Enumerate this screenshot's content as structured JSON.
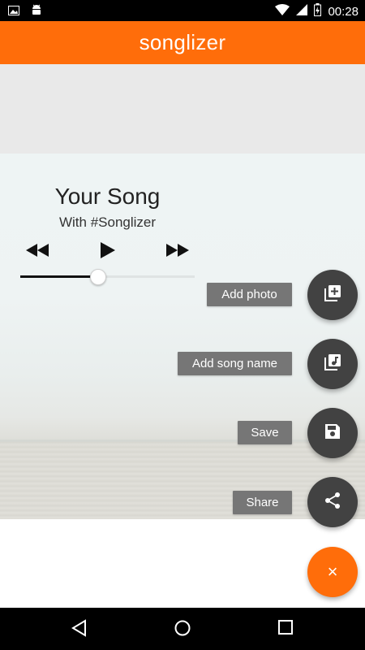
{
  "status_bar": {
    "time": "00:28",
    "icons": [
      "image-notification-icon",
      "android-debug-icon",
      "wifi-icon",
      "signal-icon",
      "battery-charging-icon"
    ]
  },
  "app_bar": {
    "title_bold": "song",
    "title_light": "lizer",
    "color": "#ff6d0a"
  },
  "player": {
    "title": "Your Song",
    "subtitle": "With #Songlizer",
    "progress": 0.44
  },
  "fab_menu": {
    "items": [
      {
        "label": "Add photo",
        "icon": "add-photo-icon"
      },
      {
        "label": "Add song name",
        "icon": "add-song-icon"
      },
      {
        "label": "Save",
        "icon": "save-icon"
      },
      {
        "label": "Share",
        "icon": "share-icon"
      }
    ],
    "close_icon": "×"
  },
  "nav_bar": {
    "buttons": [
      "back-icon",
      "home-icon",
      "recents-icon"
    ]
  }
}
